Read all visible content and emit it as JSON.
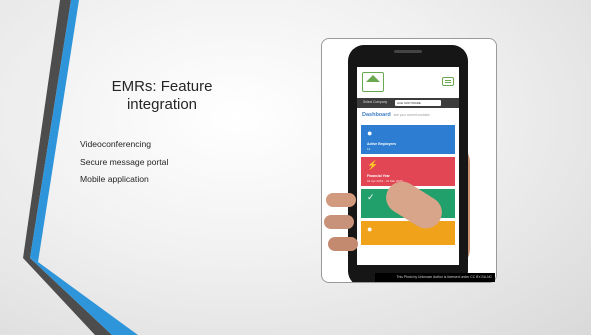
{
  "slide": {
    "title": "EMRs: Feature integration",
    "bullets": [
      "Videoconferencing",
      "Secure message portal",
      "Mobile application"
    ]
  },
  "photo": {
    "attribution": "This Photo by Unknown Author is licensed under CC BY-SA-NC"
  },
  "app": {
    "company_label": "Select Company",
    "company_value": "ACE SOFTWARE",
    "dashboard_title": "Dashboard",
    "dashboard_subtitle": "see your current modules",
    "cards": [
      {
        "label": "Active Employees",
        "sub": "14",
        "color": "#2d7dd2",
        "icon": "user-icon"
      },
      {
        "label": "Financial Year",
        "sub": "01 Apr 2019 - 31 Mar 2020",
        "color": "#e24553",
        "icon": "lightning-icon"
      },
      {
        "label": "",
        "sub": "",
        "color": "#22a06b",
        "icon": "check-icon"
      },
      {
        "label": "",
        "sub": "",
        "color": "#f0a21a",
        "icon": "user-icon"
      }
    ]
  },
  "colors": {
    "accent_blue": "#2f8fd8",
    "accent_dark": "#595959",
    "text": "#262626"
  }
}
